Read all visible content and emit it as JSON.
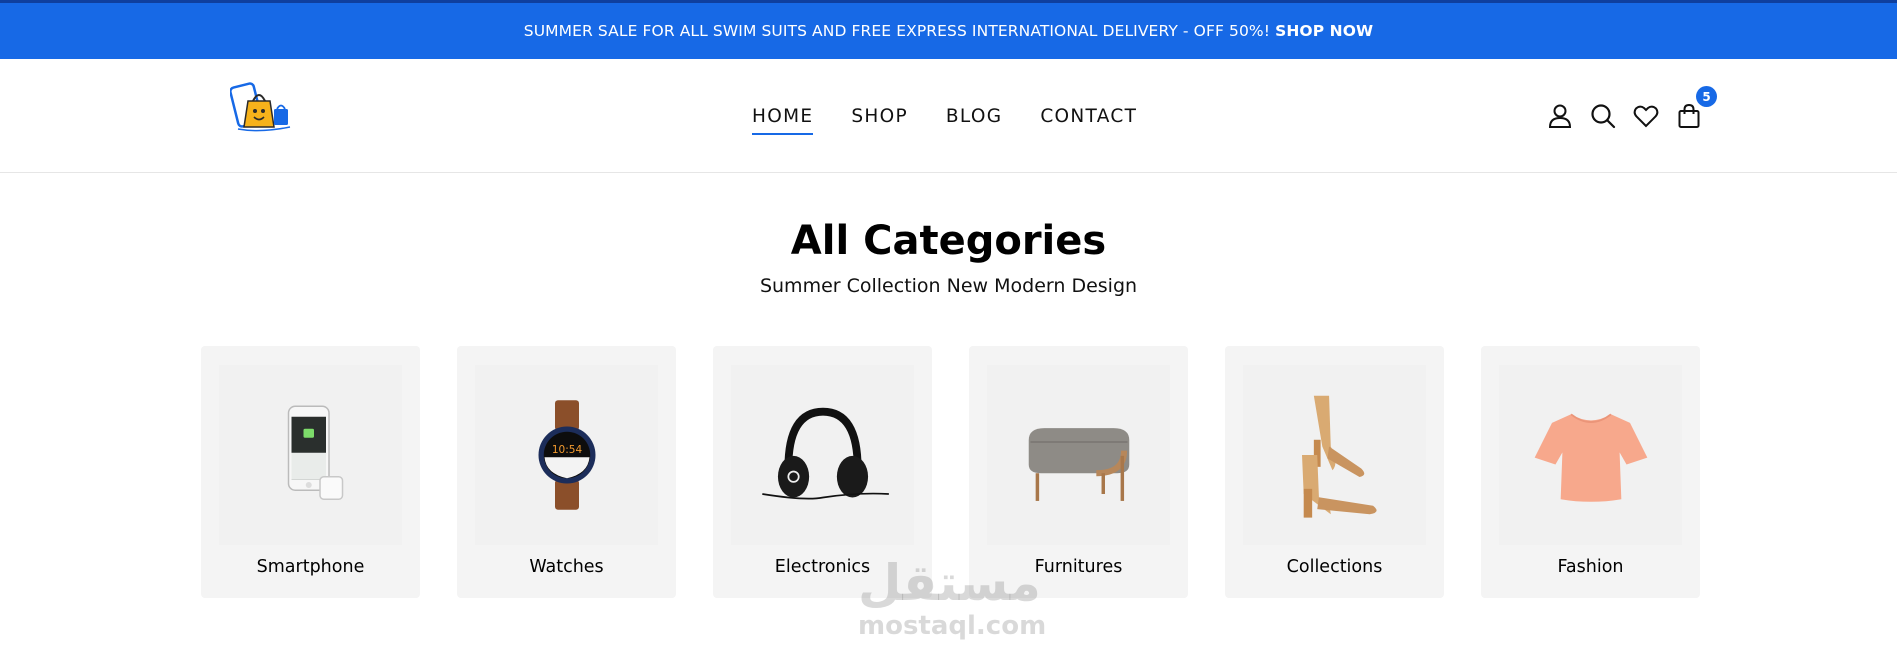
{
  "announcement": {
    "text": "SUMMER SALE FOR ALL SWIM SUITS AND FREE EXPRESS INTERNATIONAL DELIVERY - OFF 50%!",
    "cta": "SHOP NOW",
    "color": "#1769e6"
  },
  "header": {
    "logo": "shopping-bag-mascot-logo",
    "nav": [
      {
        "label": "HOME",
        "active": true
      },
      {
        "label": "SHOP",
        "active": false
      },
      {
        "label": "BLOG",
        "active": false
      },
      {
        "label": "CONTACT",
        "active": false
      }
    ],
    "icons": [
      "user-icon",
      "search-icon",
      "heart-icon",
      "cart-icon"
    ],
    "cart_count": "5"
  },
  "categories": {
    "title": "All Categories",
    "subtitle": "Summer Collection New Modern Design",
    "items": [
      {
        "label": "Smartphone",
        "image": "smartphone-image"
      },
      {
        "label": "Watches",
        "image": "watch-image"
      },
      {
        "label": "Electronics",
        "image": "headphones-image"
      },
      {
        "label": "Furnitures",
        "image": "ottoman-image"
      },
      {
        "label": "Collections",
        "image": "sandals-image"
      },
      {
        "label": "Fashion",
        "image": "blouse-image"
      }
    ]
  },
  "watermark": {
    "arabic": "مستقل",
    "latin": "mostaql.com"
  }
}
